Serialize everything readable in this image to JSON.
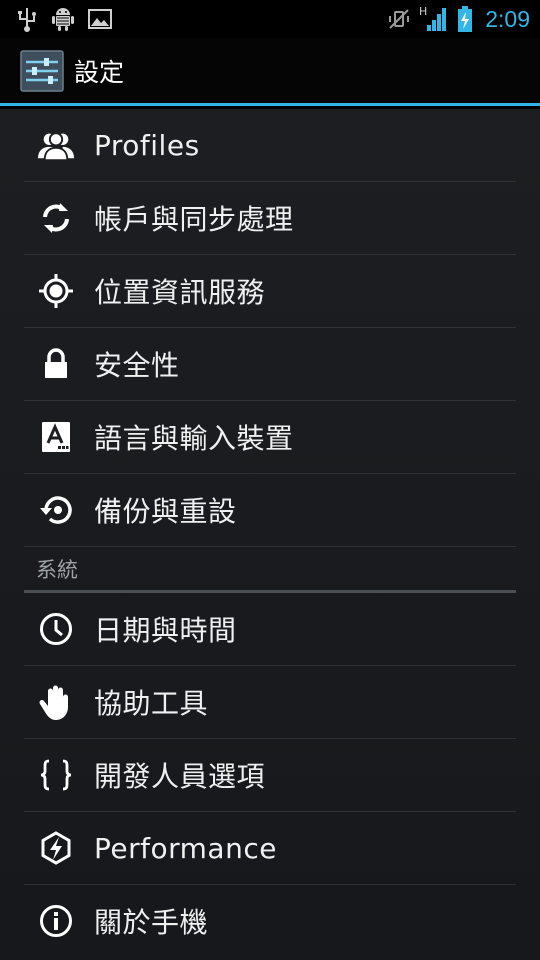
{
  "status": {
    "time": "2:09",
    "network_type": "H",
    "icons": [
      "usb-icon",
      "android-debug-icon",
      "image-icon",
      "vibrate-icon",
      "signal-icon",
      "battery-charging-icon"
    ]
  },
  "actionbar": {
    "title": "設定",
    "icon": "settings-app-icon"
  },
  "personal_items": [
    {
      "label": "Profiles",
      "icon": "profiles-icon"
    },
    {
      "label": "帳戶與同步處理",
      "icon": "sync-icon"
    },
    {
      "label": "位置資訊服務",
      "icon": "location-icon"
    },
    {
      "label": "安全性",
      "icon": "lock-icon"
    },
    {
      "label": "語言與輸入裝置",
      "icon": "language-icon"
    },
    {
      "label": "備份與重設",
      "icon": "backup-icon"
    }
  ],
  "system_header": "系統",
  "system_items": [
    {
      "label": "日期與時間",
      "icon": "clock-icon"
    },
    {
      "label": "協助工具",
      "icon": "hand-icon"
    },
    {
      "label": "開發人員選項",
      "icon": "braces-icon"
    },
    {
      "label": "Performance",
      "icon": "performance-icon"
    },
    {
      "label": "關於手機",
      "icon": "info-icon"
    }
  ],
  "colors": {
    "accent": "#33b5e5",
    "background": "#1c1e21",
    "divider": "#2e3135"
  }
}
